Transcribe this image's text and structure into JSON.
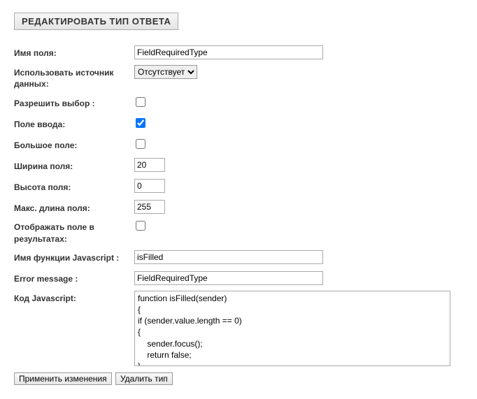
{
  "header": {
    "title": "РЕДАКТИРОВАТЬ ТИП ОТВЕТА"
  },
  "form": {
    "fieldName": {
      "label": "Имя поля:",
      "value": "FieldRequiredType"
    },
    "dataSource": {
      "label": "Использовать источник данных:",
      "selected": "Отсутствует"
    },
    "allowSelect": {
      "label": "Разрешить выбор :",
      "checked": false
    },
    "inputField": {
      "label": "Поле ввода:",
      "checked": true
    },
    "bigField": {
      "label": "Большое поле:",
      "checked": false
    },
    "width": {
      "label": "Ширина поля:",
      "value": "20"
    },
    "height": {
      "label": "Высота поля:",
      "value": "0"
    },
    "maxLen": {
      "label": "Макс. длина поля:",
      "value": "255"
    },
    "showInResults": {
      "label": "Отображать поле в результатах:",
      "checked": false
    },
    "jsFuncName": {
      "label": "Имя функции Javascript :",
      "value": "isFilled"
    },
    "errorMsg": {
      "label": "Error message :",
      "value": "FieldRequiredType"
    },
    "jsCode": {
      "label": "Код Javascript:",
      "value": "function isFilled(sender)\n{\nif (sender.value.length == 0)\n{\n    sender.focus();\n    return false;\n}\nelse"
    }
  },
  "buttons": {
    "apply": "Применить изменения",
    "delete": "Удалить тип"
  }
}
